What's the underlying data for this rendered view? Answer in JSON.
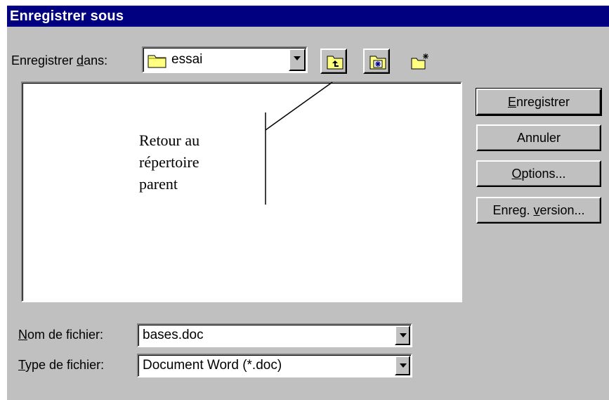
{
  "window": {
    "title": "Enregistrer sous"
  },
  "save_in": {
    "label_prefix": "Enregistrer ",
    "label_mnemonic": "d",
    "label_suffix": "ans:",
    "value": "essai",
    "folder_icon": "folder-icon"
  },
  "toolbar": {
    "icons": [
      "up-one-level-icon",
      "favorites-folder-icon",
      "new-folder-icon"
    ]
  },
  "buttons": {
    "save": {
      "mnemonic": "E",
      "rest": "nregistrer"
    },
    "cancel": {
      "label": "Annuler"
    },
    "options": {
      "mnemonic": "O",
      "rest": "ptions..."
    },
    "save_version": {
      "before": "Enreg. ",
      "mnemonic": "v",
      "after": "ersion..."
    }
  },
  "annotation": {
    "line1": "Retour au",
    "line2": "répertoire",
    "line3": "parent"
  },
  "file_name": {
    "label_mnemonic": "N",
    "label_rest": "om de fichier:",
    "value": "bases.doc"
  },
  "file_type": {
    "label_mnemonic": "T",
    "label_rest": "ype de fichier:",
    "value": "Document Word (*.doc)"
  },
  "colors": {
    "title_bar": "#000080",
    "dialog_face": "#c0c0c0",
    "folder_yellow": "#ffff80"
  }
}
